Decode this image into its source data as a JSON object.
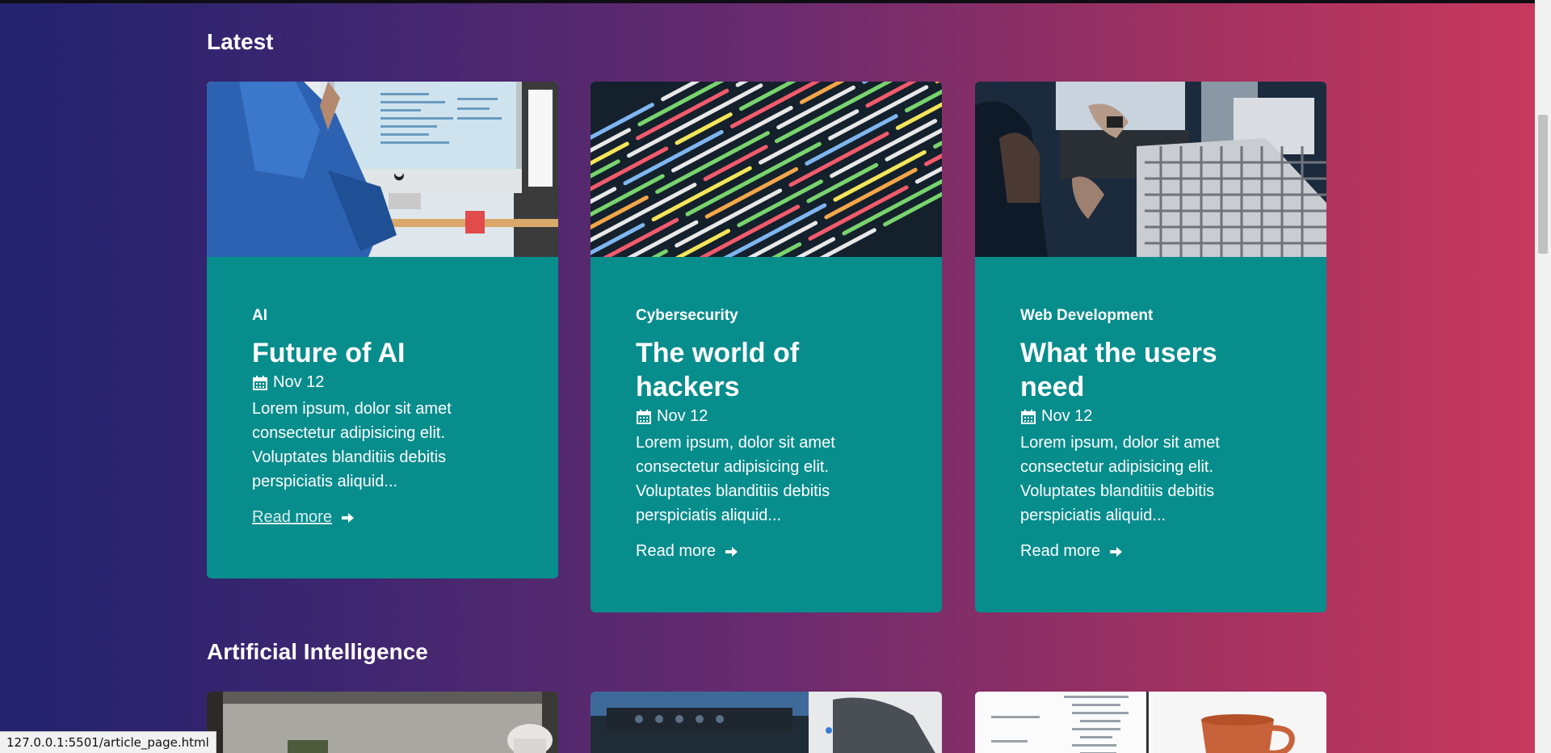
{
  "sections": {
    "latest_title": "Latest",
    "ai_title": "Artificial Intelligence"
  },
  "latest_cards": [
    {
      "category": "AI",
      "title": "Future of AI",
      "date": "Nov 12",
      "excerpt": "Lorem ipsum, dolor sit amet consectetur adipisicing elit. Voluptates blanditiis debitis perspiciatis aliquid...",
      "link": "Read more"
    },
    {
      "category": "Cybersecurity",
      "title": "The world of hackers",
      "date": "Nov 12",
      "excerpt": "Lorem ipsum, dolor sit amet consectetur adipisicing elit. Voluptates blanditiis debitis perspiciatis aliquid...",
      "link": "Read more"
    },
    {
      "category": "Web Development",
      "title": "What the users need",
      "date": "Nov 12",
      "excerpt": "Lorem ipsum, dolor sit amet consectetur adipisicing elit. Voluptates blanditiis debitis perspiciatis aliquid...",
      "link": "Read more"
    }
  ],
  "status_url": "127.0.0.1:5501/article_page.html",
  "colors": {
    "card_bg": "#088d8d",
    "gradient_start": "#22226e",
    "gradient_end": "#c9385e"
  },
  "icons": {
    "date": "calendar-icon",
    "link": "arrow-right-icon"
  }
}
